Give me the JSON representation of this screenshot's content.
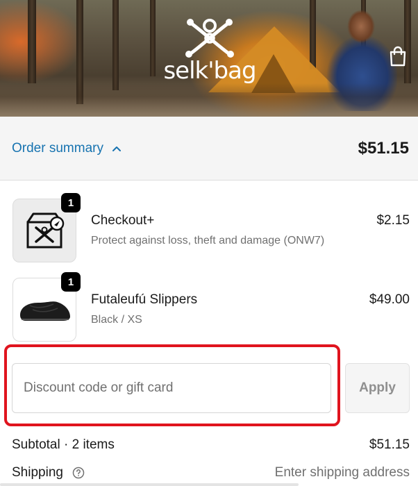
{
  "brand": {
    "name": "selk'bag",
    "accent": "#1773b0",
    "highlight": "#e0141e"
  },
  "header": {
    "cart_icon": "shopping-bag-icon"
  },
  "summary": {
    "toggle_label": "Order summary",
    "toggle_icon": "chevron-up-icon",
    "total": "$51.15"
  },
  "items": [
    {
      "name": "Checkout+",
      "variant": "Protect against loss, theft and damage (ONW7)",
      "price": "$2.15",
      "quantity": "1",
      "icon": "package-protection-icon"
    },
    {
      "name": "Futaleufú Slippers",
      "variant": "Black / XS",
      "price": "$49.00",
      "quantity": "1",
      "icon": "slipper-icon"
    }
  ],
  "discount": {
    "placeholder": "Discount code or gift card",
    "value": "",
    "apply_label": "Apply"
  },
  "totals": {
    "subtotal_label": "Subtotal · 2 items",
    "subtotal_value": "$51.15",
    "shipping_label": "Shipping",
    "shipping_value": "Enter shipping address",
    "shipping_help_icon": "question-circle-icon"
  }
}
